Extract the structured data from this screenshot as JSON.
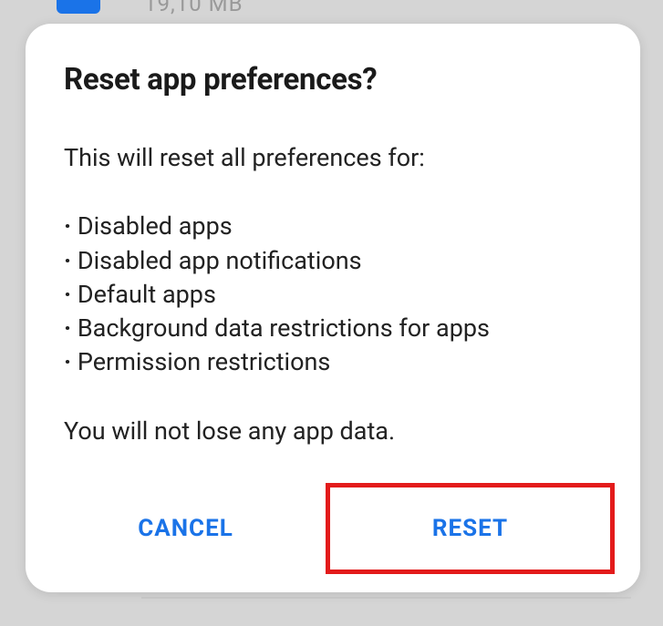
{
  "background": {
    "partial_text": "19,10 MB"
  },
  "dialog": {
    "title": "Reset app preferences?",
    "intro": "This will reset all preferences for:",
    "items": [
      "Disabled apps",
      "Disabled app notifications",
      "Default apps",
      "Background data restrictions for apps",
      "Permission restrictions"
    ],
    "footer": "You will not lose any app data.",
    "cancel_label": "CANCEL",
    "confirm_label": "RESET"
  }
}
